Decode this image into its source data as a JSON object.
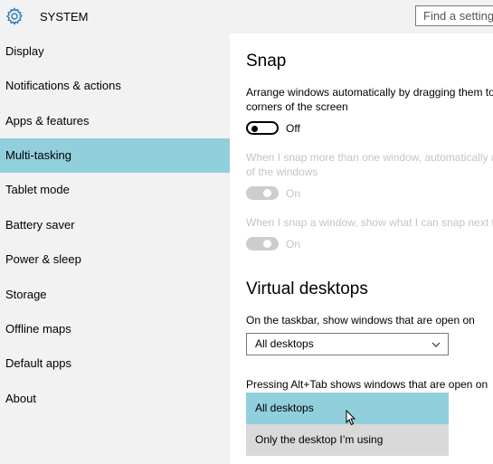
{
  "header": {
    "title": "SYSTEM",
    "icon": "gear-icon",
    "search": {
      "placeholder": "Find a setting"
    }
  },
  "sidebar": {
    "items": [
      {
        "label": "Display"
      },
      {
        "label": "Notifications & actions"
      },
      {
        "label": "Apps & features"
      },
      {
        "label": "Multi-tasking",
        "selected": true
      },
      {
        "label": "Tablet mode"
      },
      {
        "label": "Battery saver"
      },
      {
        "label": "Power & sleep"
      },
      {
        "label": "Storage"
      },
      {
        "label": "Offline maps"
      },
      {
        "label": "Default apps"
      },
      {
        "label": "About"
      }
    ]
  },
  "snap": {
    "heading": "Snap",
    "desc_line1": "Arrange windows automatically by dragging them to the sides or",
    "desc_line2": "corners of the screen",
    "toggle1_state": "Off",
    "opt2_line1": "When I snap more than one window, automatically adjust the size",
    "opt2_line2": "of the windows",
    "toggle2_state": "On",
    "opt3_line1": "When I snap a window, show what I can snap next to it",
    "toggle3_state": "On"
  },
  "virtual_desktops": {
    "heading": "Virtual desktops",
    "taskbar_label": "On the taskbar, show windows that are open on",
    "taskbar_value": "All desktops",
    "alttab_label": "Pressing Alt+Tab shows windows that are open on",
    "alttab_options": [
      {
        "label": "All desktops",
        "highlighted": true
      },
      {
        "label": "Only the desktop I’m using"
      }
    ]
  },
  "colors": {
    "selection": "#92cfdc",
    "gear_icon": "#2b7ab7"
  }
}
